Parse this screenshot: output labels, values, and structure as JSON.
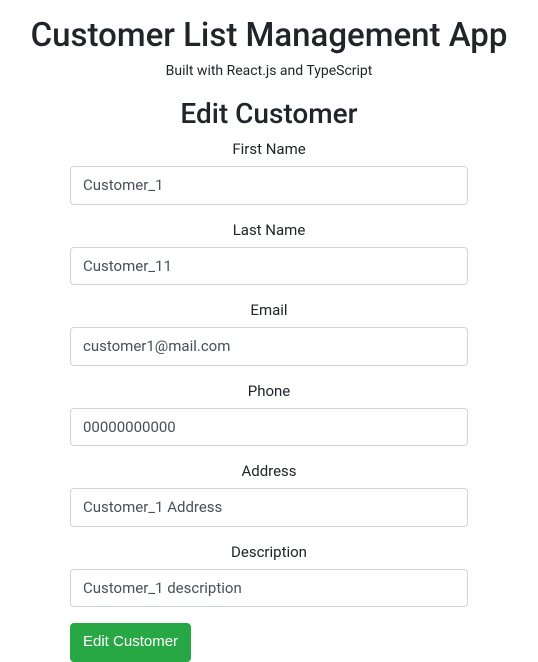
{
  "header": {
    "title": "Customer List Management App",
    "subtitle": "Built with React.js and TypeScript"
  },
  "form": {
    "title": "Edit Customer",
    "fields": {
      "firstName": {
        "label": "First Name",
        "value": "Customer_1"
      },
      "lastName": {
        "label": "Last Name",
        "value": "Customer_11"
      },
      "email": {
        "label": "Email",
        "value": "customer1@mail.com"
      },
      "phone": {
        "label": "Phone",
        "value": "00000000000"
      },
      "address": {
        "label": "Address",
        "value": "Customer_1 Address"
      },
      "description": {
        "label": "Description",
        "value": "Customer_1 description"
      }
    },
    "submitLabel": "Edit Customer"
  }
}
